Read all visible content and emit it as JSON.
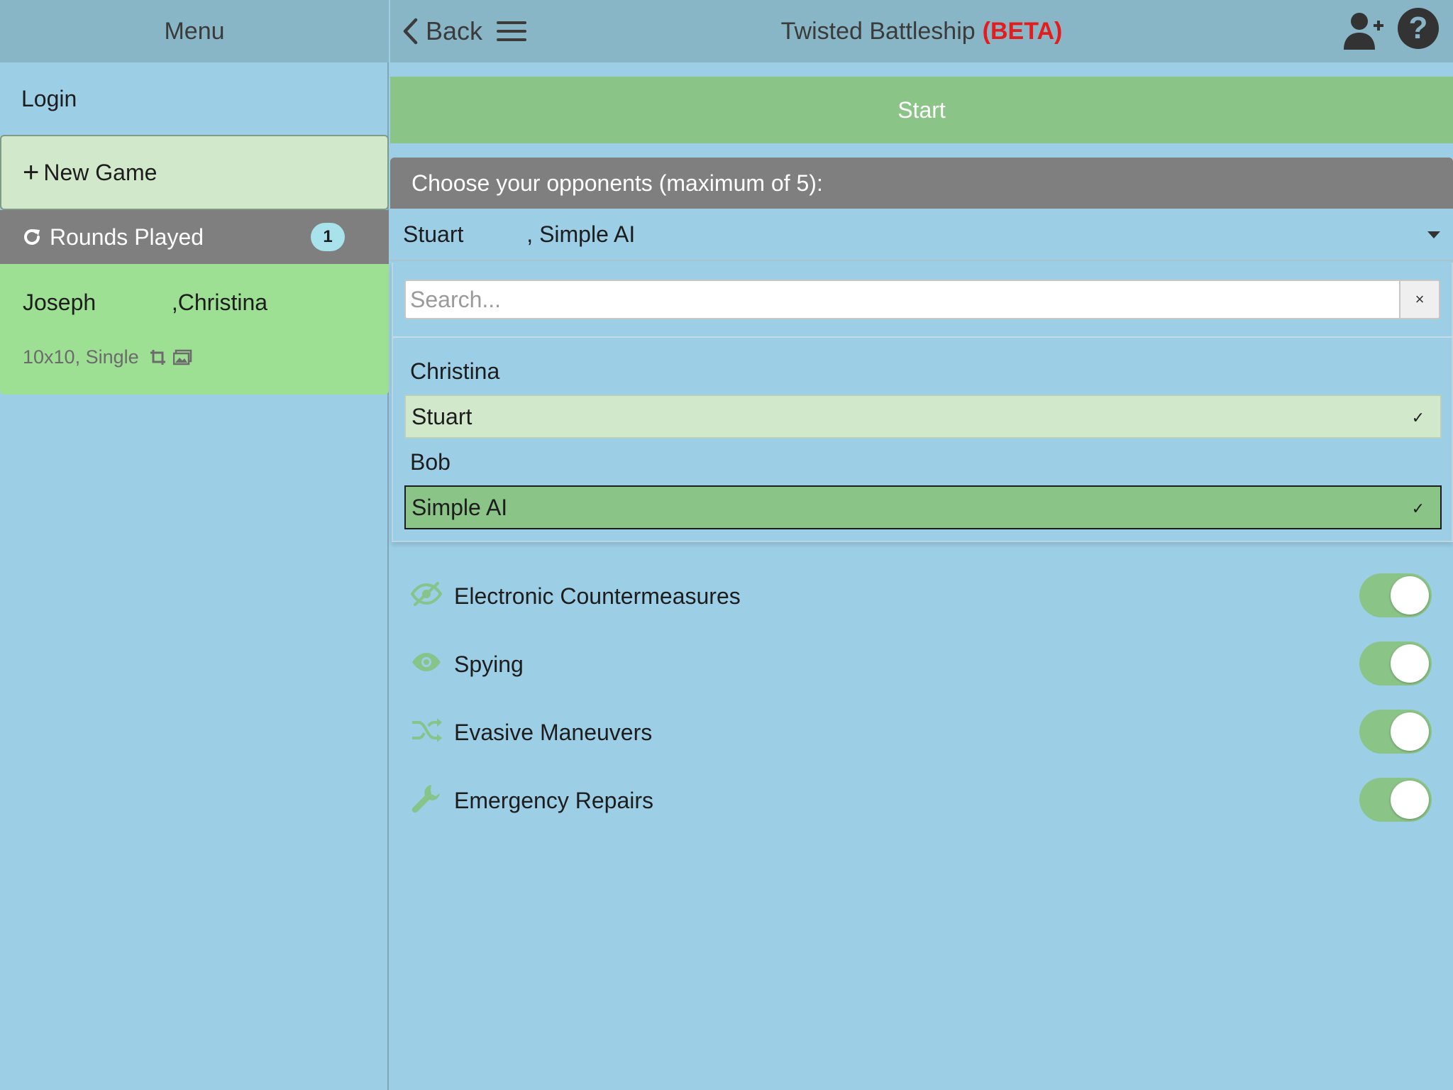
{
  "menu": {
    "title": "Menu",
    "login_label": "Login",
    "new_game_label": "New Game",
    "rounds": {
      "label": "Rounds Played",
      "count": "1"
    },
    "game_card": {
      "players": "Joseph            ,Christina",
      "details": "10x10, Single"
    }
  },
  "header": {
    "back_label": "Back",
    "title": "Twisted Battleship",
    "beta_label": "(BETA)",
    "help_label": "?"
  },
  "main": {
    "start_label": "Start",
    "opponents": {
      "header": "Choose your opponents (maximum of 5):",
      "selected_text": "Stuart          , Simple AI",
      "search_placeholder": "Search...",
      "clear_label": "×",
      "options": [
        {
          "label": "Christina",
          "selected": false,
          "check": ""
        },
        {
          "label": "Stuart",
          "selected": true,
          "check": "✓"
        },
        {
          "label": "Bob",
          "selected": false,
          "check": ""
        },
        {
          "label": "Simple AI",
          "selected": true,
          "check": "✓"
        }
      ]
    },
    "features": [
      {
        "label": "Electronic Countermeasures",
        "icon": "eye-slash-icon",
        "enabled": true
      },
      {
        "label": "Spying",
        "icon": "eye-icon",
        "enabled": true
      },
      {
        "label": "Evasive Maneuvers",
        "icon": "shuffle-icon",
        "enabled": true
      },
      {
        "label": "Emergency Repairs",
        "icon": "wrench-icon",
        "enabled": true
      }
    ]
  },
  "colors": {
    "background": "#9ccee6",
    "header_bar": "#88b6c6",
    "accent_green": "#8bc487",
    "beta_red": "#e41c1c",
    "section_gray": "#7f7f7f"
  }
}
